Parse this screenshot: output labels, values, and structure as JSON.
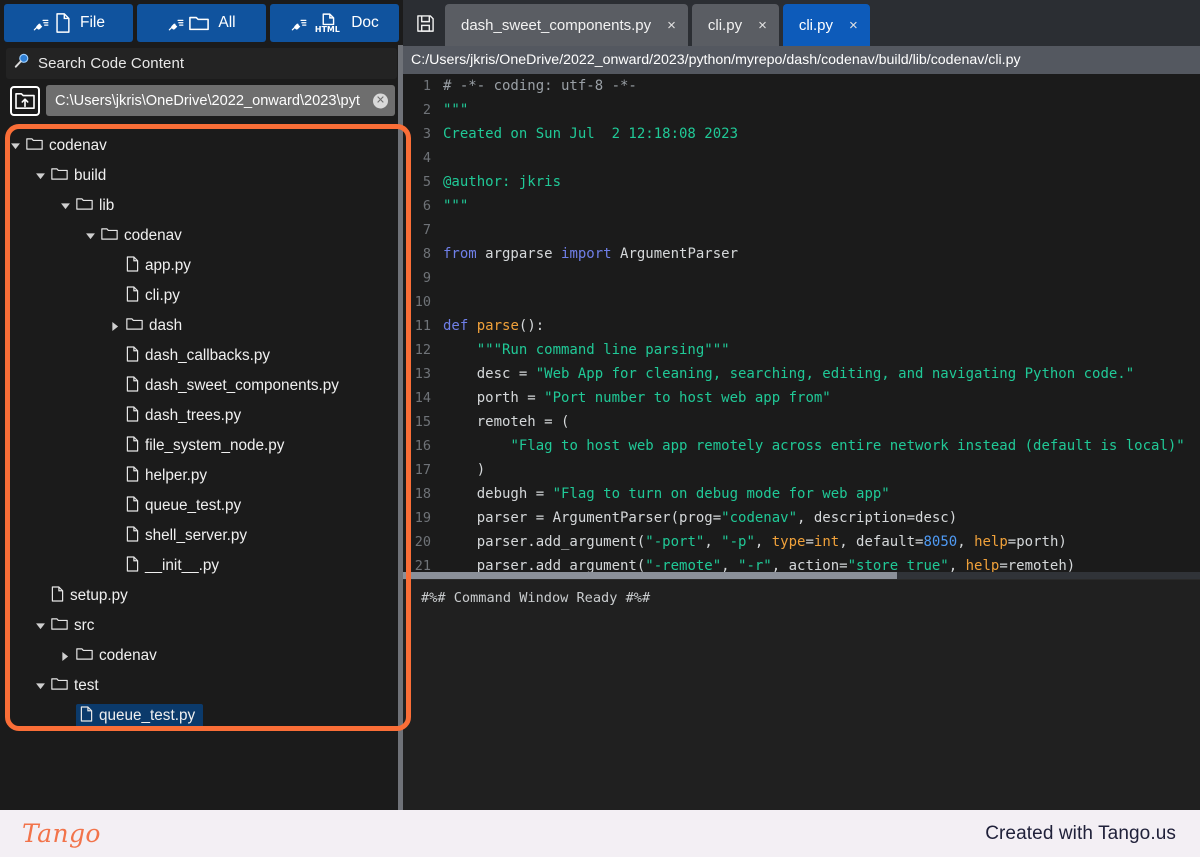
{
  "toolbar": {
    "buttons": [
      {
        "label": "File",
        "icon": "broom-file-icon"
      },
      {
        "label": "All",
        "icon": "broom-folder-icon"
      },
      {
        "label": "Doc",
        "icon": "broom-html-icon"
      }
    ]
  },
  "search": {
    "placeholder": "Search Code Content",
    "value": "Search Code Content",
    "icon": "search-icon"
  },
  "path_input": {
    "icon": "open-folder-up-icon",
    "value": "C:\\Users\\jkris\\OneDrive\\2022_onward\\2023\\pyt",
    "clear_icon": "clear-icon"
  },
  "tree": [
    {
      "label": "codenav",
      "type": "folder",
      "depth": 0,
      "state": "expanded",
      "selected": false
    },
    {
      "label": "build",
      "type": "folder",
      "depth": 1,
      "state": "expanded",
      "selected": false
    },
    {
      "label": "lib",
      "type": "folder",
      "depth": 2,
      "state": "expanded",
      "selected": false
    },
    {
      "label": "codenav",
      "type": "folder",
      "depth": 3,
      "state": "expanded",
      "selected": false
    },
    {
      "label": "app.py",
      "type": "file",
      "depth": 4,
      "state": "none",
      "selected": false
    },
    {
      "label": "cli.py",
      "type": "file",
      "depth": 4,
      "state": "none",
      "selected": false
    },
    {
      "label": "dash",
      "type": "folder",
      "depth": 4,
      "state": "collapsed",
      "selected": false
    },
    {
      "label": "dash_callbacks.py",
      "type": "file",
      "depth": 4,
      "state": "none",
      "selected": false
    },
    {
      "label": "dash_sweet_components.py",
      "type": "file",
      "depth": 4,
      "state": "none",
      "selected": false
    },
    {
      "label": "dash_trees.py",
      "type": "file",
      "depth": 4,
      "state": "none",
      "selected": false
    },
    {
      "label": "file_system_node.py",
      "type": "file",
      "depth": 4,
      "state": "none",
      "selected": false
    },
    {
      "label": "helper.py",
      "type": "file",
      "depth": 4,
      "state": "none",
      "selected": false
    },
    {
      "label": "queue_test.py",
      "type": "file",
      "depth": 4,
      "state": "none",
      "selected": false
    },
    {
      "label": "shell_server.py",
      "type": "file",
      "depth": 4,
      "state": "none",
      "selected": false
    },
    {
      "label": "__init__.py",
      "type": "file",
      "depth": 4,
      "state": "none",
      "selected": false
    },
    {
      "label": "setup.py",
      "type": "file",
      "depth": 1,
      "state": "none",
      "selected": false
    },
    {
      "label": "src",
      "type": "folder",
      "depth": 1,
      "state": "expanded",
      "selected": false
    },
    {
      "label": "codenav",
      "type": "folder",
      "depth": 2,
      "state": "collapsed",
      "selected": false
    },
    {
      "label": "test",
      "type": "folder",
      "depth": 1,
      "state": "expanded",
      "selected": false
    },
    {
      "label": "queue_test.py",
      "type": "file",
      "depth": 2,
      "state": "none",
      "selected": true
    }
  ],
  "editor": {
    "save_icon": "save-disk-icon",
    "tabs": [
      {
        "label": "dash_sweet_components.py",
        "active": false,
        "close": "×"
      },
      {
        "label": "cli.py",
        "active": false,
        "close": "×"
      },
      {
        "label": "cli.py",
        "active": true,
        "close": "×"
      }
    ],
    "path": "C:/Users/jkris/OneDrive/2022_onward/2023/python/myrepo/dash/codenav/build/lib/codenav/cli.py",
    "lines": [
      {
        "n": "1",
        "parts": [
          {
            "t": "# -*- coding: utf-8 -*-",
            "c": "c"
          }
        ]
      },
      {
        "n": "2",
        "parts": [
          {
            "t": "\"\"\"",
            "c": "s"
          }
        ]
      },
      {
        "n": "3",
        "parts": [
          {
            "t": "Created on Sun Jul  2 12:18:08 2023",
            "c": "s"
          }
        ]
      },
      {
        "n": "4",
        "parts": [
          {
            "t": "",
            "c": "s"
          }
        ]
      },
      {
        "n": "5",
        "parts": [
          {
            "t": "@author: jkris",
            "c": "s"
          }
        ]
      },
      {
        "n": "6",
        "parts": [
          {
            "t": "\"\"\"",
            "c": "s"
          }
        ]
      },
      {
        "n": "7",
        "parts": [
          {
            "t": "",
            "c": "codetext"
          }
        ]
      },
      {
        "n": "8",
        "parts": [
          {
            "t": "from",
            "c": "k"
          },
          {
            "t": " argparse ",
            "c": "codetext"
          },
          {
            "t": "import",
            "c": "k"
          },
          {
            "t": " ArgumentParser",
            "c": "codetext"
          }
        ]
      },
      {
        "n": "9",
        "parts": [
          {
            "t": "",
            "c": "codetext"
          }
        ]
      },
      {
        "n": "10",
        "parts": [
          {
            "t": "",
            "c": "codetext"
          }
        ]
      },
      {
        "n": "11",
        "parts": [
          {
            "t": "def",
            "c": "k"
          },
          {
            "t": " ",
            "c": "codetext"
          },
          {
            "t": "parse",
            "c": "kf"
          },
          {
            "t": "():",
            "c": "codetext"
          }
        ]
      },
      {
        "n": "12",
        "parts": [
          {
            "t": "    ",
            "c": "codetext"
          },
          {
            "t": "\"\"\"Run command line parsing\"\"\"",
            "c": "s"
          }
        ]
      },
      {
        "n": "13",
        "parts": [
          {
            "t": "    desc = ",
            "c": "codetext"
          },
          {
            "t": "\"Web App for cleaning, searching, editing, and navigating Python code.\"",
            "c": "s"
          }
        ]
      },
      {
        "n": "14",
        "parts": [
          {
            "t": "    porth = ",
            "c": "codetext"
          },
          {
            "t": "\"Port number to host web app from\"",
            "c": "s"
          }
        ]
      },
      {
        "n": "15",
        "parts": [
          {
            "t": "    remoteh = (",
            "c": "codetext"
          }
        ]
      },
      {
        "n": "16",
        "parts": [
          {
            "t": "        ",
            "c": "codetext"
          },
          {
            "t": "\"Flag to host web app remotely across entire network instead (default is local)\"",
            "c": "s"
          }
        ]
      },
      {
        "n": "17",
        "parts": [
          {
            "t": "    )",
            "c": "codetext"
          }
        ]
      },
      {
        "n": "18",
        "parts": [
          {
            "t": "    debugh = ",
            "c": "codetext"
          },
          {
            "t": "\"Flag to turn on debug mode for web app\"",
            "c": "s"
          }
        ]
      },
      {
        "n": "19",
        "parts": [
          {
            "t": "    parser = ArgumentParser(prog=",
            "c": "codetext"
          },
          {
            "t": "\"codenav\"",
            "c": "s"
          },
          {
            "t": ", description=desc)",
            "c": "codetext"
          }
        ]
      },
      {
        "n": "20",
        "parts": [
          {
            "t": "    parser.add_argument(",
            "c": "codetext"
          },
          {
            "t": "\"-port\"",
            "c": "s"
          },
          {
            "t": ", ",
            "c": "codetext"
          },
          {
            "t": "\"-p\"",
            "c": "s"
          },
          {
            "t": ", ",
            "c": "codetext"
          },
          {
            "t": "type",
            "c": "kw"
          },
          {
            "t": "=",
            "c": "codetext"
          },
          {
            "t": "int",
            "c": "kf"
          },
          {
            "t": ", default=",
            "c": "codetext"
          },
          {
            "t": "8050",
            "c": "n"
          },
          {
            "t": ", ",
            "c": "codetext"
          },
          {
            "t": "help",
            "c": "kw"
          },
          {
            "t": "=porth)",
            "c": "codetext"
          }
        ]
      },
      {
        "n": "21",
        "parts": [
          {
            "t": "    parser.add_argument(",
            "c": "codetext"
          },
          {
            "t": "\"-remote\"",
            "c": "s"
          },
          {
            "t": ", ",
            "c": "codetext"
          },
          {
            "t": "\"-r\"",
            "c": "s"
          },
          {
            "t": ", action=",
            "c": "codetext"
          },
          {
            "t": "\"store true\"",
            "c": "s"
          },
          {
            "t": ", ",
            "c": "codetext"
          },
          {
            "t": "help",
            "c": "kw"
          },
          {
            "t": "=remoteh)",
            "c": "codetext"
          }
        ]
      }
    ]
  },
  "terminal": {
    "text": "#%# Command Window Ready #%#"
  },
  "footer": {
    "logo": "Tango",
    "text": "Created with Tango.us"
  },
  "colors": {
    "accent_orange": "#fa6e37",
    "button_blue": "#10539e",
    "tab_active_blue": "#0d5bba",
    "selection_blue": "#0b3a6b",
    "string_green": "#20c997",
    "keyword_blue": "#6f7fe8",
    "kwarg_orange": "#f0a13a",
    "number_blue": "#4f9bf5",
    "editor_bg": "#1b1b1b"
  }
}
